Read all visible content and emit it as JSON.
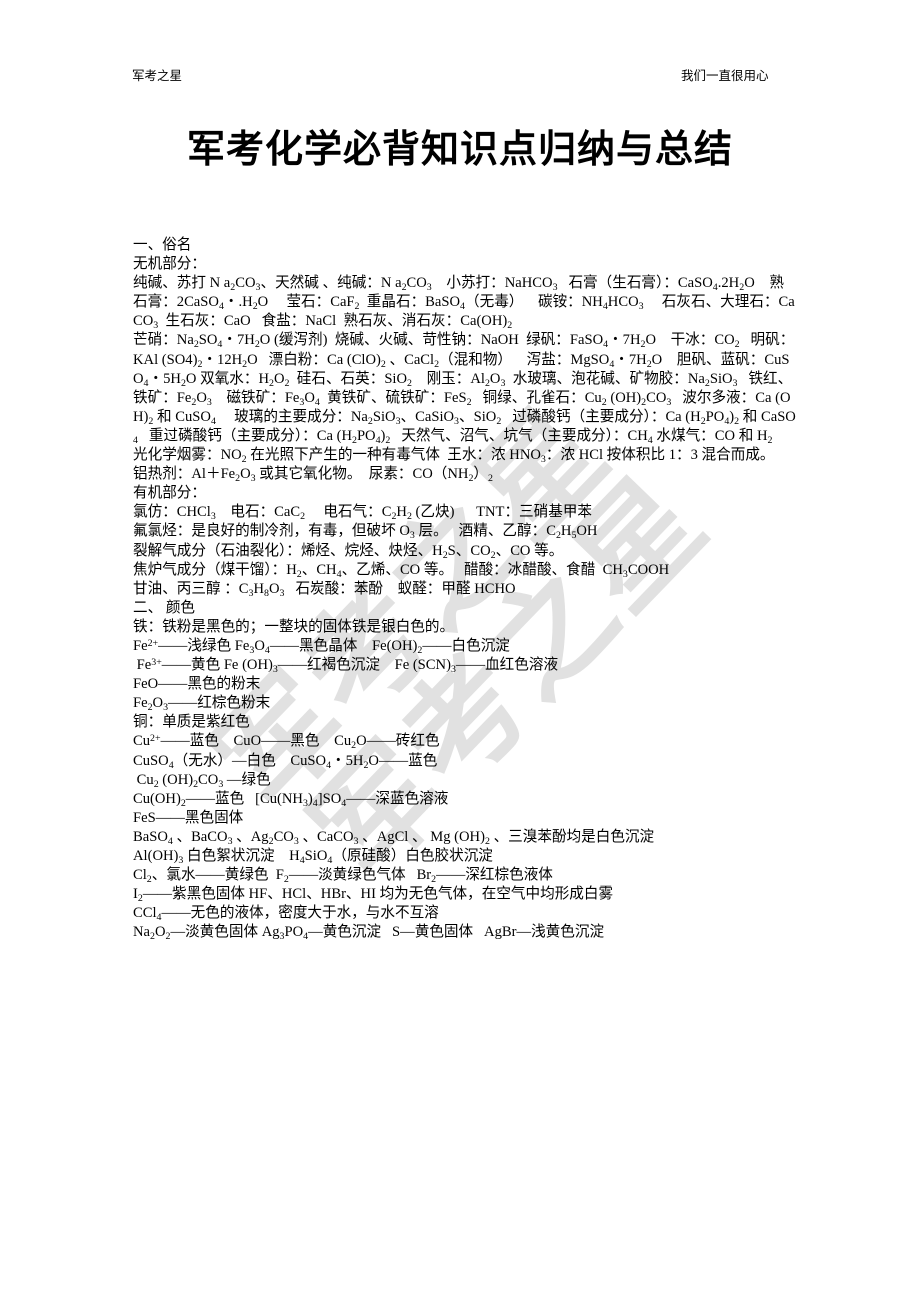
{
  "header": {
    "left": "军考之星",
    "right": "我们一直很用心"
  },
  "title": "军考化学必背知识点归纳与总结",
  "watermark": {
    "line1": "军考之星",
    "line2": "军考之星"
  },
  "body": {
    "lines": [
      "一、俗名",
      "无机部分：",
      "纯碱、苏打 N a<sub>2</sub>CO<sub>3</sub>、天然碱 、纯碱：N a<sub>2</sub>CO<sub>3</sub>    小苏打：NaHCO<sub>3</sub>   石膏（生石膏）：CaSO<sub>4</sub>.2H<sub>2</sub>O    熟石膏：2CaSO<sub>4</sub>・.H<sub>2</sub>O     莹石：CaF<sub>2</sub>  重晶石：BaSO<sub>4</sub>（无毒）    碳铵：NH<sub>4</sub>HCO<sub>3</sub>     石灰石、大理石：CaCO<sub>3</sub>  生石灰：CaO   食盐：NaCl  熟石灰、消石灰：Ca(OH)<sub>2</sub>",
      "芒硝：Na<sub>2</sub>SO<sub>4</sub>・7H<sub>2</sub>O (缓泻剂)  烧碱、火碱、苛性钠：NaOH  绿矾：FaSO<sub>4</sub>・7H<sub>2</sub>O    干冰：CO<sub>2</sub>   明矾：KAl (SO4)<sub>2</sub>・12H<sub>2</sub>O   漂白粉：Ca (ClO)<sub>2</sub> 、CaCl<sub>2</sub>（混和物）    泻盐：MgSO<sub>4</sub>・7H<sub>2</sub>O    胆矾、蓝矾：CuSO<sub>4</sub>・5H<sub>2</sub>O 双氧水：H<sub>2</sub>O<sub>2</sub>  硅石、石英：SiO<sub>2</sub>    刚玉：Al<sub>2</sub>O<sub>3</sub>  水玻璃、泡花碱、矿物胶：Na<sub>2</sub>SiO<sub>3</sub>   铁红、铁矿：Fe<sub>2</sub>O<sub>3</sub>    磁铁矿：Fe<sub>3</sub>O<sub>4</sub>  黄铁矿、硫铁矿：FeS<sub>2</sub>   铜绿、孔雀石：Cu<sub>2</sub> (OH)<sub>2</sub>CO<sub>3</sub>   波尔多液：Ca (OH)<sub>2</sub> 和 CuSO<sub>4</sub>     玻璃的主要成分：Na<sub>2</sub>SiO<sub>3</sub>、CaSiO<sub>3</sub>、SiO<sub>2</sub>   过磷酸钙（主要成分）：Ca (H<sub>2</sub>PO<sub>4</sub>)<sub>2</sub> 和 CaSO<sub>4</sub>   重过磷酸钙（主要成分）：Ca (H<sub>2</sub>PO<sub>4</sub>)<sub>2</sub>   天然气、沼气、坑气（主要成分）：CH<sub>4</sub> 水煤气：CO 和 H<sub>2</sub>",
      "光化学烟雾：NO<sub>2</sub> 在光照下产生的一种有毒气体  王水：浓 HNO<sub>3</sub>：浓 HCl 按体积比 1：3 混合而成。",
      "铝热剂：Al＋Fe<sub>2</sub>O<sub>3</sub> 或其它氧化物。  尿素：CO（NH<sub>2</sub>）<sub>2</sub>",
      "有机部分：",
      "氯仿：CHCl<sub>3</sub>    电石：CaC<sub>2</sub>     电石气：C<sub>2</sub>H<sub>2</sub> (乙炔)      TNT：三硝基甲苯",
      "氟氯烃：是良好的制冷剂，有毒，但破坏 O<sub>3</sub> 层。   酒精、乙醇：C<sub>2</sub>H<sub>5</sub>OH",
      "裂解气成分（石油裂化）：烯烃、烷烃、炔烃、H<sub>2</sub>S、CO<sub>2</sub>、CO 等。",
      "焦炉气成分（煤干馏）：H<sub>2</sub>、CH<sub>4</sub>、乙烯、CO 等。   醋酸：冰醋酸、食醋  CH<sub>3</sub>COOH",
      "甘油、丙三醇 ：C<sub>3</sub>H<sub>8</sub>O<sub>3</sub>   石炭酸：苯酚    蚁醛：甲醛 HCHO",
      "二、 颜色",
      "铁：铁粉是黑色的；一整块的固体铁是银白色的。",
      "Fe<sup>2+</sup>——浅绿色 Fe<sub>3</sub>O<sub>4</sub>——黑色晶体    Fe(OH)<sub>2</sub>——白色沉淀",
      " Fe<sup>3+</sup>——黄色 Fe (OH)<sub>3</sub>——红褐色沉淀    Fe (SCN)<sub>3</sub>——血红色溶液",
      "FeO——黑色的粉末",
      "Fe<sub>2</sub>O<sub>3</sub>——红棕色粉末",
      "铜：单质是紫红色",
      "Cu<sup>2+</sup>——蓝色    CuO——黑色    Cu<sub>2</sub>O——砖红色",
      "CuSO<sub>4</sub>（无水）—白色    CuSO<sub>4</sub>・5H<sub>2</sub>O——蓝色",
      " Cu<sub>2</sub> (OH)<sub>2</sub>CO<sub>3</sub> —绿色",
      "Cu(OH)<sub>2</sub>——蓝色   [Cu(NH<sub>3</sub>)<sub>4</sub>]SO<sub>4</sub>——深蓝色溶液",
      "FeS——黑色固体",
      "BaSO<sub>4</sub> 、BaCO<sub>3</sub> 、Ag<sub>2</sub>CO<sub>3</sub> 、CaCO<sub>3</sub> 、AgCl 、 Mg (OH)<sub>2</sub> 、三溴苯酚均是白色沉淀",
      "Al(OH)<sub>3</sub> 白色絮状沉淀    H<sub>4</sub>SiO<sub>4</sub>（原硅酸）白色胶状沉淀",
      "Cl<sub>2</sub>、氯水——黄绿色  F<sub>2</sub>——淡黄绿色气体   Br<sub>2</sub>——深红棕色液体",
      "I<sub>2</sub>——紫黑色固体 HF、HCl、HBr、HI 均为无色气体，在空气中均形成白雾",
      "CCl<sub>4</sub>——无色的液体，密度大于水，与水不互溶",
      "Na<sub>2</sub>O<sub>2</sub>—淡黄色固体 Ag<sub>3</sub>PO<sub>4</sub>—黄色沉淀   S—黄色固体   AgBr—浅黄色沉淀"
    ]
  }
}
